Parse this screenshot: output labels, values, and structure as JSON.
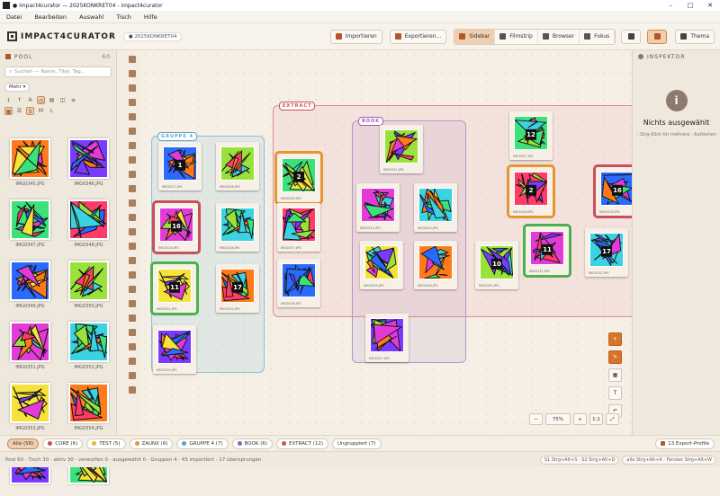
{
  "window": {
    "title": "● impact4curator — 2025KONKRET04 - impact4curator"
  },
  "menu": [
    "Datei",
    "Bearbeiten",
    "Auswahl",
    "Tisch",
    "Hilfe"
  ],
  "header": {
    "app_name": "IMPACT4CURATOR",
    "project_chip": "● 2025KONKRET04",
    "import_label": "Importieren",
    "export_label": "Exportieren...",
    "views": [
      "Sidebar",
      "Filmstrip",
      "Browser",
      "Fokus"
    ],
    "theme_label": "Thema"
  },
  "pool": {
    "title": "POOL",
    "count": "60",
    "search_placeholder": "Suchen — Name, Titel, Tag...",
    "more_label": "Mehr ▾",
    "sizes": [
      "S",
      "M",
      "L"
    ],
    "thumbs": [
      "IMG0345.JPG",
      "IMG0346.JPG",
      "IMG0347.JPG",
      "IMG0348.JPG",
      "IMG0349.JPG",
      "IMG0350.JPG",
      "IMG0351.JPG",
      "IMG0352.JPG",
      "IMG0353.JPG",
      "IMG0354.JPG",
      "",
      ""
    ]
  },
  "groups": [
    {
      "tag": "GRUPPE 4",
      "color": "#5ba3c9"
    },
    {
      "tag": "EXTRACT",
      "color": "#c9505a"
    },
    {
      "tag": "BOOK",
      "color": "#a35bb5"
    }
  ],
  "cards": [
    {
      "cap": "IMG0327.JPG",
      "badge": "1"
    },
    {
      "cap": "IMG0346.JPG",
      "badge": ""
    },
    {
      "cap": "IMG0328.JPG",
      "badge": "16"
    },
    {
      "cap": "IMG0346.JPG",
      "badge": ""
    },
    {
      "cap": "IMG0331.JPG",
      "badge": "11"
    },
    {
      "cap": "IMG0332.JPG",
      "badge": "17"
    },
    {
      "cap": "IMG0333.JPG",
      "badge": ""
    },
    {
      "cap": "IMG0326.JPG",
      "badge": "2"
    },
    {
      "cap": "IMG0337.JPG",
      "badge": ""
    },
    {
      "cap": "IMG0338.JPG",
      "badge": ""
    },
    {
      "cap": "IMG0342.JPG",
      "badge": ""
    },
    {
      "cap": "IMG0343.JPG",
      "badge": ""
    },
    {
      "cap": "IMG0344.JPG",
      "badge": ""
    },
    {
      "cap": "IMG0345.JPG",
      "badge": ""
    },
    {
      "cap": "IMG0346.JPG",
      "badge": ""
    },
    {
      "cap": "IMG0347.JPG",
      "badge": ""
    },
    {
      "cap": "IMG0327.JPG",
      "badge": "12"
    },
    {
      "cap": "IMG0326.JPG",
      "badge": "2"
    },
    {
      "cap": "IMG0328.JPG",
      "badge": "16"
    },
    {
      "cap": "IMG0330.JPG",
      "badge": "10"
    },
    {
      "cap": "IMG0331.JPG",
      "badge": "11"
    },
    {
      "cap": "IMG0332.JPG",
      "badge": "17"
    }
  ],
  "inspector": {
    "title": "INSPEKTOR",
    "empty_title": "Nichts ausgewählt",
    "hint": "– Strg-Klick für mehrere · Aufziehen"
  },
  "zoom": {
    "value": "75%",
    "one_to_one": "1:1"
  },
  "filters": [
    {
      "label": "Alle (58)",
      "color": ""
    },
    {
      "label": "CORE (6)",
      "color": "#c9505a"
    },
    {
      "label": "TEST (5)",
      "color": "#e6b830"
    },
    {
      "label": "ZAUNX (6)",
      "color": "#e69530"
    },
    {
      "label": "GRUPPE 4 (7)",
      "color": "#5ba3c9"
    },
    {
      "label": "BOOK (6)",
      "color": "#a35bb5"
    },
    {
      "label": "EXTRACT (12)",
      "color": "#c9505a"
    },
    {
      "label": "Ungruppiert (7)",
      "color": ""
    }
  ],
  "export_profiles": "13 Export-Profile",
  "status": {
    "text": "Pool 60 · Tisch 30 · aktiv 30 · verworfen 0 · ausgewählt 0 · Gruppen 4 · 43 importiert · 17 übersprungen",
    "shortcuts": [
      "S1 Strg+Alt+S · S2 Strg+Alt+D",
      "alle Strg+Alt+A · Fenster Strg+Alt+W"
    ]
  }
}
